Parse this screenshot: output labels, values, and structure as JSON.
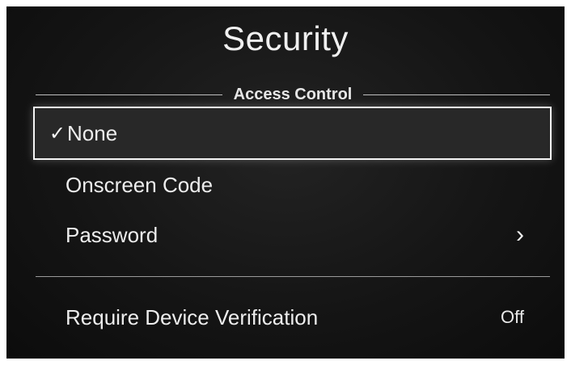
{
  "screen": {
    "title": "Security"
  },
  "access_control": {
    "header": "Access Control",
    "options": [
      {
        "label": "None",
        "checked": true,
        "check_glyph": "✓"
      },
      {
        "label": "Onscreen Code",
        "checked": false
      },
      {
        "label": "Password",
        "checked": false,
        "chevron": "›"
      }
    ]
  },
  "device_verification": {
    "label": "Require Device Verification",
    "value": "Off"
  },
  "icons": {
    "checkmark": "checkmark-icon",
    "chevron": "chevron-right-icon"
  }
}
